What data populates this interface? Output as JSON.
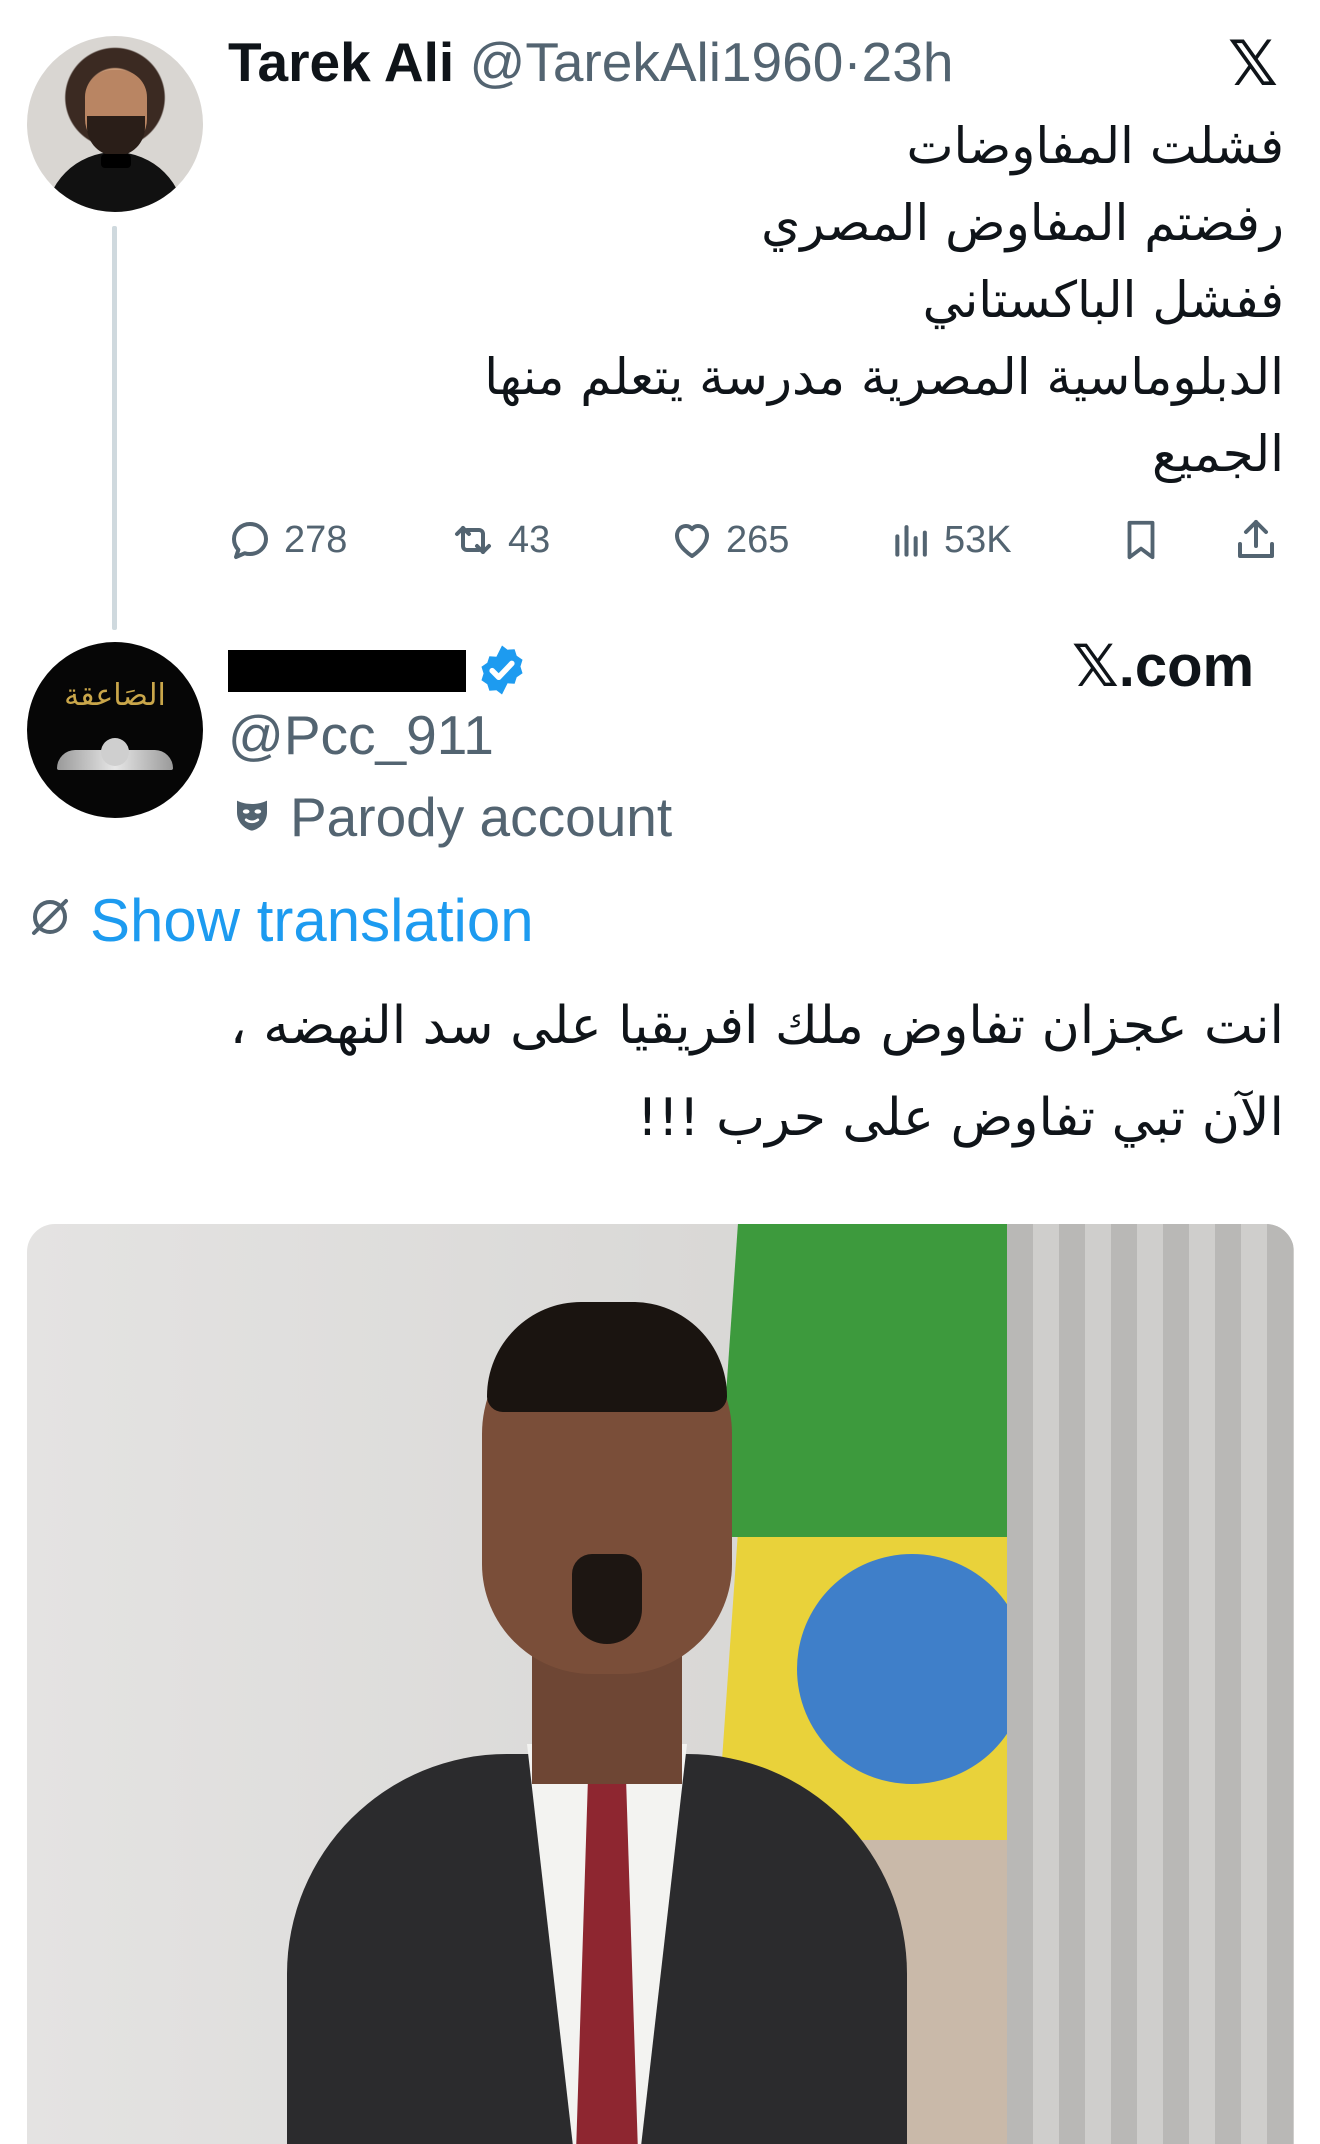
{
  "quoted_tweet": {
    "author_name": "Tarek Ali",
    "author_handle": "@TarekAli1960",
    "separator": "·",
    "time": "23h",
    "platform_logo": "𝕏",
    "text_lines": [
      "فشلت المفاوضات",
      "رفضتم المفاوض المصري",
      "ففشل الباكستاني",
      "الدبلوماسية المصرية مدرسة يتعلم منها",
      "الجميع"
    ],
    "actions": {
      "replies": "278",
      "reposts": "43",
      "likes": "265",
      "views": "53K"
    }
  },
  "main_tweet": {
    "author_handle": "@Pcc_911",
    "account_label": "Parody account",
    "source": "𝕏.com",
    "avatar_text": "الصَاعقة",
    "translate_label": "Show translation",
    "text_lines": [
      "انت عجزان تفاوض ملك افريقيا على سد النهضه ،",
      "الآن تبي تفاوض على حرب !!!"
    ]
  },
  "icons": {
    "reply": "reply-icon",
    "repost": "repost-icon",
    "like": "heart-icon",
    "views": "views-icon",
    "bookmark": "bookmark-icon",
    "share": "share-icon",
    "verified": "verified-badge-icon",
    "parody": "parody-mask-icon",
    "translate": "translate-globe-icon"
  },
  "colors": {
    "accent": "#1d9bf0",
    "secondary_text": "#536471",
    "primary_text": "#0f1419"
  }
}
